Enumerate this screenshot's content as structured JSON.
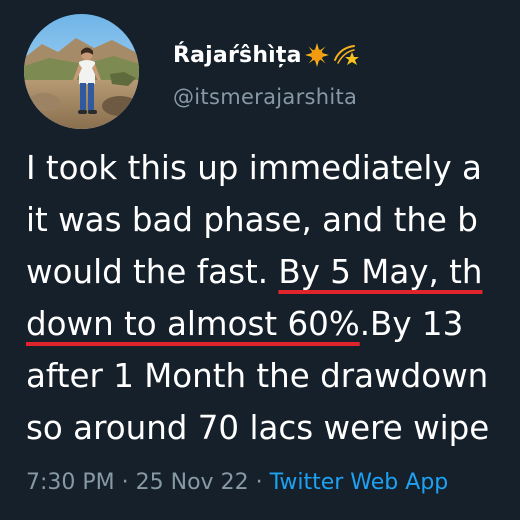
{
  "tweet": {
    "author": {
      "display_name": "Ŕajaŕŝhìța",
      "emoji_icons": [
        "sun-with-sparkle-icon",
        "shooting-star-icon"
      ],
      "handle": "@itsmerajarshita"
    },
    "text_lines": [
      {
        "before": "I took this up immediately a",
        "highlight": "",
        "after": ""
      },
      {
        "before": "it was bad phase, and the b",
        "highlight": "",
        "after": ""
      },
      {
        "before": "would the fast. ",
        "highlight": "By 5 May, th",
        "after": ""
      },
      {
        "before": "",
        "highlight": "down to almost 60%",
        "after": ".By 13"
      },
      {
        "before": "after 1 Month the drawdown",
        "highlight": "",
        "after": ""
      },
      {
        "before": "so around 70 lacs were wipe",
        "highlight": "",
        "after": ""
      }
    ],
    "meta": {
      "time": "7:30 PM",
      "separator": "·",
      "date": "25 Nov 22",
      "source": "Twitter Web App"
    },
    "colors": {
      "background": "#15202b",
      "text": "#ffffff",
      "muted": "#8899a6",
      "link": "#1da1f2",
      "underline_annotation": "#e0242c"
    }
  }
}
